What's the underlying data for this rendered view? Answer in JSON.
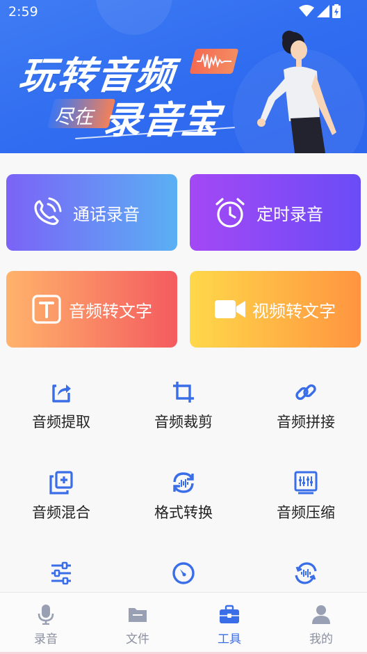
{
  "status_bar": {
    "time": "2:59"
  },
  "banner": {
    "headline_line1": "玩转音频",
    "sub_text": "尽在",
    "headline_line2": "录音宝"
  },
  "feature_cards": [
    {
      "label": "通话录音",
      "icon": "phone-wave-icon"
    },
    {
      "label": "定时录音",
      "icon": "alarm-clock-icon"
    },
    {
      "label": "音频转文字",
      "icon": "text-t-icon"
    },
    {
      "label": "视频转文字",
      "icon": "video-camera-icon"
    }
  ],
  "tools": [
    {
      "label": "音频提取",
      "icon": "extract-icon"
    },
    {
      "label": "音频裁剪",
      "icon": "crop-icon"
    },
    {
      "label": "音频拼接",
      "icon": "link-icon"
    },
    {
      "label": "音频混合",
      "icon": "layers-plus-icon"
    },
    {
      "label": "格式转换",
      "icon": "convert-icon"
    },
    {
      "label": "音频压缩",
      "icon": "equalizer-icon"
    },
    {
      "label": "",
      "icon": "sliders-icon"
    },
    {
      "label": "",
      "icon": "speed-dial-icon"
    },
    {
      "label": "",
      "icon": "reverse-audio-icon"
    }
  ],
  "tabbar": {
    "items": [
      {
        "label": "录音",
        "icon": "microphone-icon",
        "active": false
      },
      {
        "label": "文件",
        "icon": "folder-icon",
        "active": false
      },
      {
        "label": "工具",
        "icon": "toolbox-icon",
        "active": true
      },
      {
        "label": "我的",
        "icon": "user-icon",
        "active": false
      }
    ]
  },
  "colors": {
    "accent": "#3a6de8",
    "banner_blue": "#2f6cf0",
    "tab_inactive": "#8b8fa0"
  }
}
